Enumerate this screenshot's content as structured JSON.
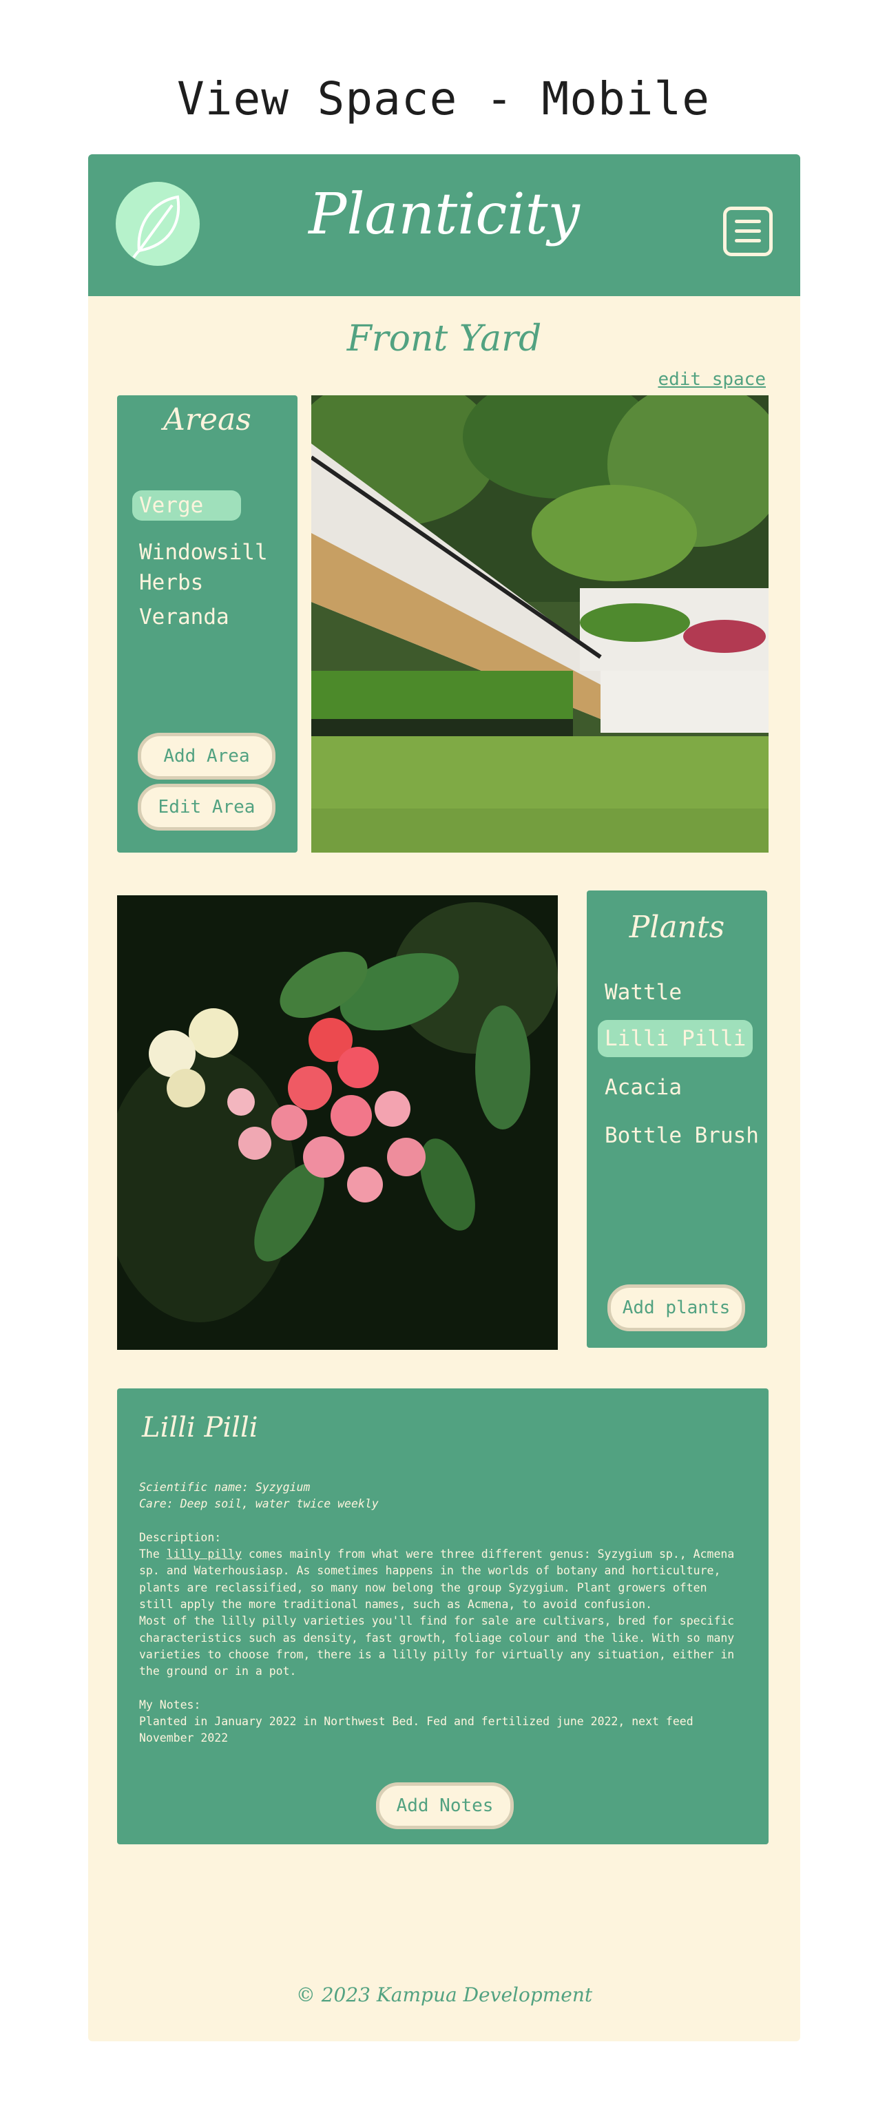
{
  "page_title": "View Space - Mobile",
  "header": {
    "brand": "Planticity",
    "logo_icon": "leaf-icon",
    "menu_icon": "hamburger-menu-icon"
  },
  "space": {
    "title": "Front Yard",
    "edit_link": "edit space"
  },
  "areas": {
    "title": "Areas",
    "items": [
      {
        "label": "Verge",
        "active": true
      },
      {
        "label": "Windowsill Herbs",
        "active": false
      },
      {
        "label": "Veranda",
        "active": false
      }
    ],
    "add_button": "Add Area",
    "edit_button": "Edit Area"
  },
  "plants": {
    "title": "Plants",
    "items": [
      {
        "label": "Wattle",
        "active": false
      },
      {
        "label": "Lilli Pilli",
        "active": true
      },
      {
        "label": "Acacia",
        "active": false
      },
      {
        "label": "Bottle Brush",
        "active": false
      }
    ],
    "add_button": "Add plants"
  },
  "details": {
    "title": "Lilli Pilli",
    "scientific_name": "Scientific name: Syzygium",
    "care": "Care: Deep soil, water twice weekly",
    "description_heading": "Description:",
    "description_pre": "The ",
    "description_link": "lilly pilly",
    "description_post": " comes mainly from what were three different genus: Syzygium sp., Acmena sp. and Waterhousiasp. As sometimes happens in the worlds of botany and horticulture, plants are reclassified, so many now belong the group Syzygium. Plant growers often still apply the more traditional names, such as Acmena, to avoid confusion.",
    "description_2": "Most of the lilly pilly varieties you'll find for sale are cultivars, bred for specific characteristics such as density, fast growth, foliage colour and the like. With so many varieties to choose from, there is a lilly pilly for virtually any situation, either in the ground or in a pot.",
    "notes_heading": "My Notes:",
    "notes": "Planted in January 2022 in Northwest Bed. Fed and fertilized june 2022, next feed November 2022",
    "add_notes_button": "Add Notes"
  },
  "footer": "© 2023 Kampua Development",
  "colors": {
    "green": "#52a281",
    "cream": "#fdf4dd",
    "mint": "#b6f2cb",
    "highlight": "#9fe0bb"
  }
}
